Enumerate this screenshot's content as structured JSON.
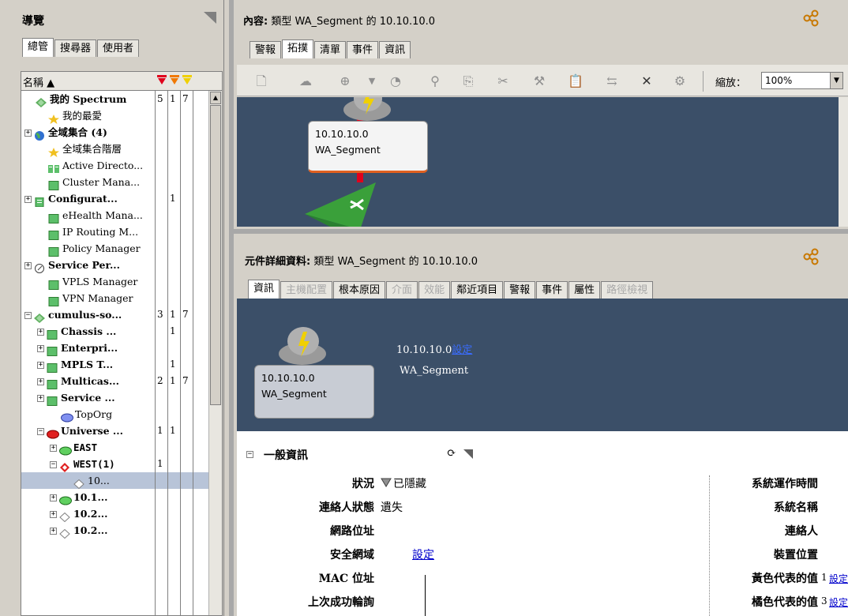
{
  "nav": {
    "title": "導覽",
    "tabs": [
      "總管",
      "搜尋器",
      "使用者"
    ],
    "columns": {
      "name": "名稱 ▲"
    },
    "tree": [
      {
        "label": "我的 Spectrum",
        "bold": true,
        "icon": "spectrum-icon",
        "c1": "5",
        "c2": "1",
        "c3": "7",
        "indent": 0,
        "exp": ""
      },
      {
        "label": "我的最愛",
        "icon": "star-icon",
        "indent": 1,
        "exp": ""
      },
      {
        "label": "全域集合 (4)",
        "bold": true,
        "icon": "globe-icon",
        "indent": 0,
        "exp": "+"
      },
      {
        "label": "全域集合階層",
        "icon": "star-icon",
        "indent": 1,
        "exp": ""
      },
      {
        "label": "Active Directo...",
        "icon": "directory-icon",
        "indent": 1,
        "exp": ""
      },
      {
        "label": "Cluster Mana...",
        "icon": "square-icon",
        "indent": 1,
        "exp": ""
      },
      {
        "label": "Configurat...",
        "bold": true,
        "icon": "config-icon",
        "c2": "1",
        "indent": 0,
        "exp": "+"
      },
      {
        "label": "eHealth Mana...",
        "icon": "square-icon",
        "indent": 1,
        "exp": ""
      },
      {
        "label": "IP Routing M...",
        "icon": "square-icon",
        "indent": 1,
        "exp": ""
      },
      {
        "label": "Policy Manager",
        "icon": "square-icon",
        "indent": 1,
        "exp": ""
      },
      {
        "label": "Service Per...",
        "bold": true,
        "icon": "clock-icon",
        "indent": 0,
        "exp": "+"
      },
      {
        "label": "VPLS Manager",
        "icon": "square-icon",
        "indent": 1,
        "exp": ""
      },
      {
        "label": "VPN Manager",
        "icon": "square-icon",
        "indent": 1,
        "exp": ""
      },
      {
        "label": "cumulus-so...",
        "bold": true,
        "icon": "spectrum-icon",
        "c1": "3",
        "c2": "1",
        "c3": "7",
        "indent": 0,
        "exp": "−"
      },
      {
        "label": "Chassis ...",
        "bold": true,
        "icon": "square-icon",
        "c2": "1",
        "indent": 1,
        "exp": "+"
      },
      {
        "label": "Enterpri...",
        "bold": true,
        "icon": "square-icon",
        "indent": 1,
        "exp": "+"
      },
      {
        "label": "MPLS T...",
        "bold": true,
        "icon": "square-icon",
        "c2": "1",
        "indent": 1,
        "exp": "+"
      },
      {
        "label": "Multicas...",
        "bold": true,
        "icon": "square-icon",
        "c1": "2",
        "c2": "1",
        "c3": "7",
        "indent": 1,
        "exp": "+"
      },
      {
        "label": "Service ...",
        "bold": true,
        "icon": "square-icon",
        "indent": 1,
        "exp": "+"
      },
      {
        "label": "TopOrg",
        "icon": "org-icon",
        "indent": 2,
        "exp": ""
      },
      {
        "label": "Universe ...",
        "bold": true,
        "icon": "universe-icon",
        "c1": "1",
        "c2": "1",
        "indent": 1,
        "exp": "−"
      },
      {
        "label": "EAST",
        "bold": true,
        "mono": true,
        "icon": "region-icon",
        "indent": 2,
        "exp": "+"
      },
      {
        "label": "WEST(1)",
        "bold": true,
        "mono": true,
        "icon": "alarm-diamond-icon",
        "c1": "1",
        "indent": 2,
        "exp": "−"
      },
      {
        "label": "10...",
        "icon": "diamond-icon",
        "indent": 3,
        "exp": "",
        "selected": true
      },
      {
        "label": "10.1...",
        "bold": true,
        "icon": "region-icon",
        "indent": 2,
        "exp": "+"
      },
      {
        "label": "10.2...",
        "bold": true,
        "icon": "diamond-icon",
        "indent": 2,
        "exp": "+"
      },
      {
        "label": "10.2...",
        "bold": true,
        "icon": "diamond-icon",
        "indent": 2,
        "exp": "+"
      }
    ]
  },
  "content": {
    "title_bold": "內容:",
    "title": "類型 WA_Segment 的 10.10.10.0",
    "tabs": [
      "警報",
      "拓撲",
      "清單",
      "事件",
      "資訊"
    ],
    "zoom_label": "縮放：",
    "zoom_value": "100%",
    "node": {
      "ip": "10.10.10.0",
      "type": "WA_Segment"
    }
  },
  "details": {
    "title_bold": "元件詳細資料:",
    "title": "類型 WA_Segment 的 10.10.10.0",
    "tabs": [
      {
        "label": "資訊",
        "state": "active"
      },
      {
        "label": "主機配置",
        "state": "disabled"
      },
      {
        "label": "根本原因",
        "state": "normal"
      },
      {
        "label": "介面",
        "state": "disabled"
      },
      {
        "label": "效能",
        "state": "disabled"
      },
      {
        "label": "鄰近項目",
        "state": "normal"
      },
      {
        "label": "警報",
        "state": "normal"
      },
      {
        "label": "事件",
        "state": "normal"
      },
      {
        "label": "屬性",
        "state": "normal"
      },
      {
        "label": "路徑檢視",
        "state": "disabled"
      }
    ],
    "node": {
      "ip": "10.10.10.0",
      "type": "WA_Segment"
    },
    "header_ip": "10.10.10.0",
    "header_set": "設定",
    "header_type": "WA_Segment",
    "section": "一般資訊",
    "fields_left": [
      {
        "label": "狀況",
        "value": "已隱藏"
      },
      {
        "label": "連絡人狀態",
        "value": "遺失"
      },
      {
        "label": "網路位址",
        "value": ""
      },
      {
        "label": "安全網域",
        "value": "設定"
      },
      {
        "label": "MAC 位址",
        "value": ""
      },
      {
        "label": "上次成功輪詢",
        "value": ""
      }
    ],
    "fields_right": [
      {
        "label": "系統運作時間",
        "value": ""
      },
      {
        "label": "系統名稱",
        "value": ""
      },
      {
        "label": "連絡人",
        "value": ""
      },
      {
        "label": "裝置位置",
        "value": ""
      },
      {
        "label": "黃色代表的值",
        "value": "1",
        "link": "設定"
      },
      {
        "label": "橘色代表的值",
        "value": "3",
        "link": "設定"
      }
    ]
  },
  "colors": {
    "topology_bg": "#3b4f68",
    "link": "#0000cc",
    "critical": "#e0001c",
    "major": "#f07800",
    "minor": "#f0d000"
  }
}
